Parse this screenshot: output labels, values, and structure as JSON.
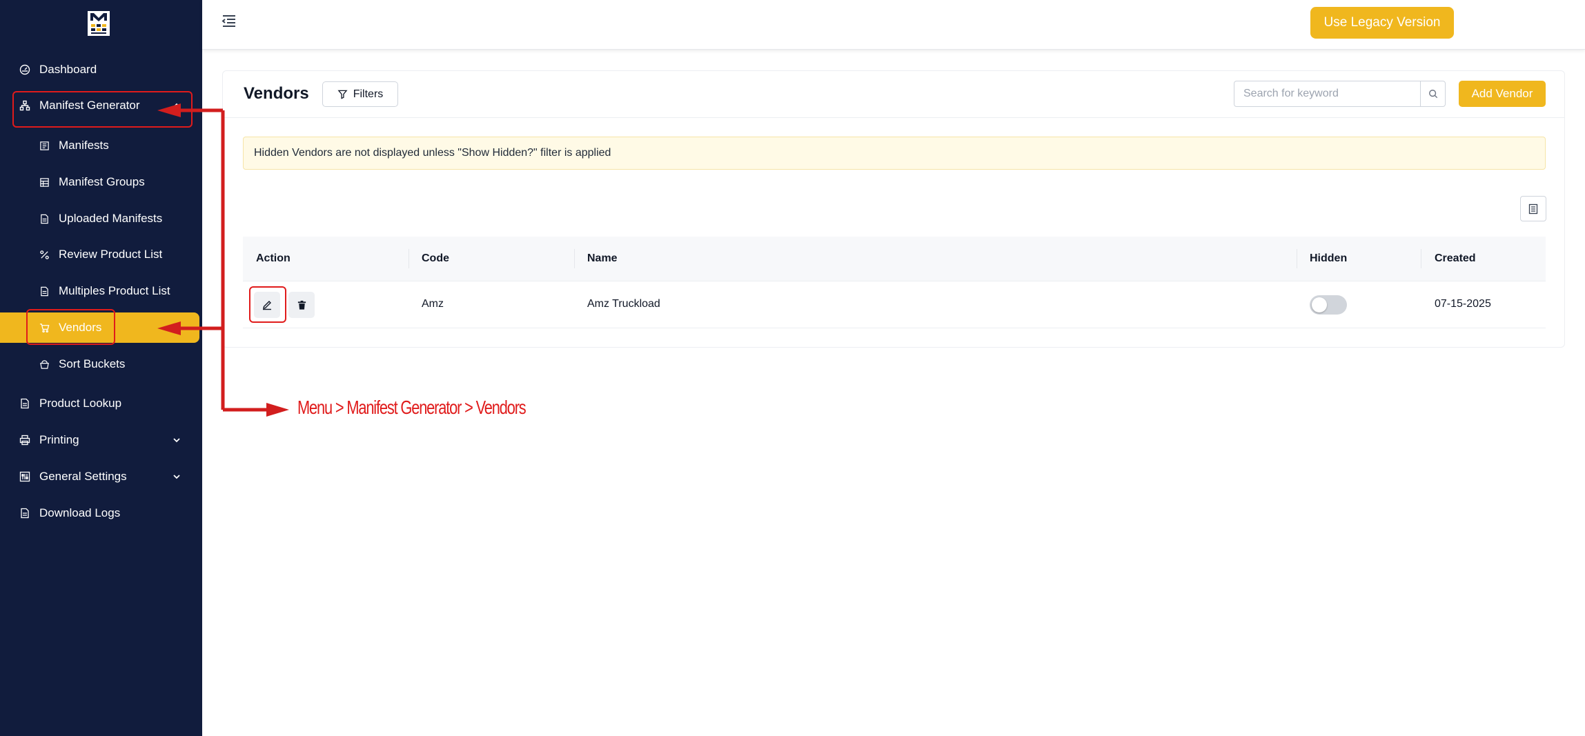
{
  "sidebar": {
    "items": [
      {
        "label": "Dashboard",
        "icon": "gauge-icon"
      },
      {
        "label": "Manifest Generator",
        "icon": "sitemap-icon"
      },
      {
        "label": "Manifests",
        "icon": "document-icon"
      },
      {
        "label": "Manifest Groups",
        "icon": "grid-icon"
      },
      {
        "label": "Uploaded Manifests",
        "icon": "file-icon"
      },
      {
        "label": "Review Product List",
        "icon": "percent-icon"
      },
      {
        "label": "Multiples Product List",
        "icon": "file-icon"
      },
      {
        "label": "Vendors",
        "icon": "cart-icon"
      },
      {
        "label": "Sort Buckets",
        "icon": "bucket-icon"
      },
      {
        "label": "Product Lookup",
        "icon": "file-icon"
      },
      {
        "label": "Printing",
        "icon": "printer-icon"
      },
      {
        "label": "General Settings",
        "icon": "settings-icon"
      },
      {
        "label": "Download Logs",
        "icon": "file-icon"
      }
    ],
    "active_color": "#f0b71e",
    "background": "#111c3d"
  },
  "topbar": {
    "legacy_label": "Use Legacy Version"
  },
  "vendors": {
    "title": "Vendors",
    "filters_label": "Filters",
    "search_placeholder": "Search for keyword",
    "add_label": "Add Vendor",
    "alert": "Hidden Vendors are not displayed unless \"Show Hidden?\" filter is applied",
    "columns": [
      "Action",
      "Code",
      "Name",
      "Hidden",
      "Created"
    ],
    "rows": [
      {
        "code": "Amz",
        "name": "Amz Truckload",
        "hidden": false,
        "created": "07-15-2025"
      }
    ]
  },
  "annotation": {
    "text": "Menu > Manifest Generator > Vendors",
    "color": "#e01b1b"
  }
}
